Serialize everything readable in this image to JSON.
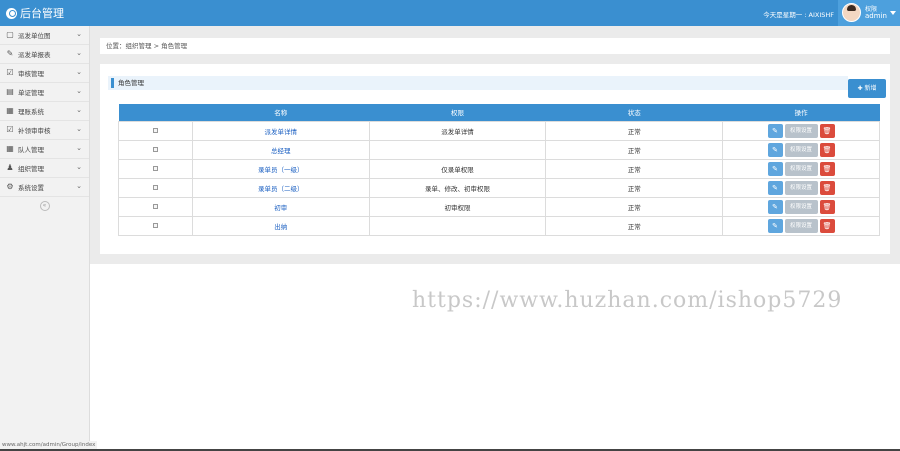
{
  "header": {
    "title": "后台管理",
    "welcome": "今天是星期一 : AIXISHF",
    "user_role": "权限",
    "user_name": "admin"
  },
  "sidebar": {
    "items": [
      {
        "label": "派发单位图",
        "icon": "map-icon"
      },
      {
        "label": "派发单报表",
        "icon": "edit-icon"
      },
      {
        "label": "审核管理",
        "icon": "check-icon"
      },
      {
        "label": "单证管理",
        "icon": "doc-icon"
      },
      {
        "label": "理账系统",
        "icon": "calendar-icon"
      },
      {
        "label": "补领审审核",
        "icon": "checkbox-icon"
      },
      {
        "label": "队人管理",
        "icon": "grid-icon"
      },
      {
        "label": "组织管理",
        "icon": "users-icon"
      },
      {
        "label": "系统设置",
        "icon": "gear-icon"
      }
    ],
    "collapse": "«"
  },
  "breadcrumb": "位置：组织管理 > 角色管理",
  "panel": {
    "title": "角色管理",
    "add_label": "✚ 新增"
  },
  "table": {
    "headers": [
      "",
      "名称",
      "权限",
      "状态",
      "操作"
    ],
    "rows": [
      {
        "name": "派发单详情",
        "perm": "派发单详情",
        "status": "正常"
      },
      {
        "name": "总经理",
        "perm": "",
        "status": "正常"
      },
      {
        "name": "录单员（一级）",
        "perm": "仅录单权限",
        "status": "正常"
      },
      {
        "name": "录单员（二级）",
        "perm": "录单、修改、初审权限",
        "status": "正常"
      },
      {
        "name": "初审",
        "perm": "初审权限",
        "status": "正常"
      },
      {
        "name": "出纳",
        "perm": "",
        "status": "正常"
      }
    ],
    "perm_button": "权限设置"
  },
  "watermark": "https://www.huzhan.com/ishop5729",
  "status_url": "www.ahjt.com/admin/Group/index",
  "colors": {
    "primary": "#3a8fd0",
    "danger": "#db4b3c"
  }
}
